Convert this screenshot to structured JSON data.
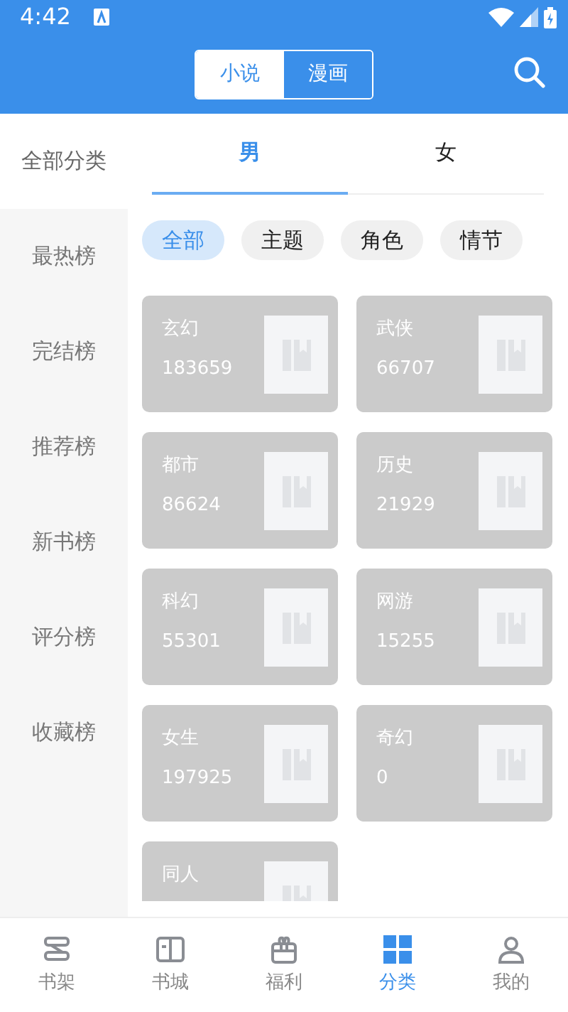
{
  "status_bar": {
    "time": "4:42"
  },
  "header": {
    "segments": [
      {
        "label": "小说",
        "selected": true
      },
      {
        "label": "漫画",
        "selected": false
      }
    ]
  },
  "all_categories_label": "全部分类",
  "gender_tabs": [
    {
      "label": "男",
      "selected": true
    },
    {
      "label": "女",
      "selected": false
    }
  ],
  "sidebar": {
    "items": [
      {
        "label": "最热榜"
      },
      {
        "label": "完结榜"
      },
      {
        "label": "推荐榜"
      },
      {
        "label": "新书榜"
      },
      {
        "label": "评分榜"
      },
      {
        "label": "收藏榜"
      }
    ]
  },
  "filters": [
    {
      "label": "全部",
      "selected": true
    },
    {
      "label": "主题",
      "selected": false
    },
    {
      "label": "角色",
      "selected": false
    },
    {
      "label": "情节",
      "selected": false
    }
  ],
  "categories": [
    {
      "name": "玄幻",
      "count": "183659"
    },
    {
      "name": "武侠",
      "count": "66707"
    },
    {
      "name": "都市",
      "count": "86624"
    },
    {
      "name": "历史",
      "count": "21929"
    },
    {
      "name": "科幻",
      "count": "55301"
    },
    {
      "name": "网游",
      "count": "15255"
    },
    {
      "name": "女生",
      "count": "197925"
    },
    {
      "name": "奇幻",
      "count": "0"
    },
    {
      "name": "同人"
    }
  ],
  "bottom_nav": [
    {
      "label": "书架",
      "kind": "shelf",
      "selected": false
    },
    {
      "label": "书城",
      "kind": "book",
      "selected": false
    },
    {
      "label": "福利",
      "kind": "gift",
      "selected": false
    },
    {
      "label": "分类",
      "kind": "grid",
      "selected": true
    },
    {
      "label": "我的",
      "kind": "person",
      "selected": false
    }
  ]
}
